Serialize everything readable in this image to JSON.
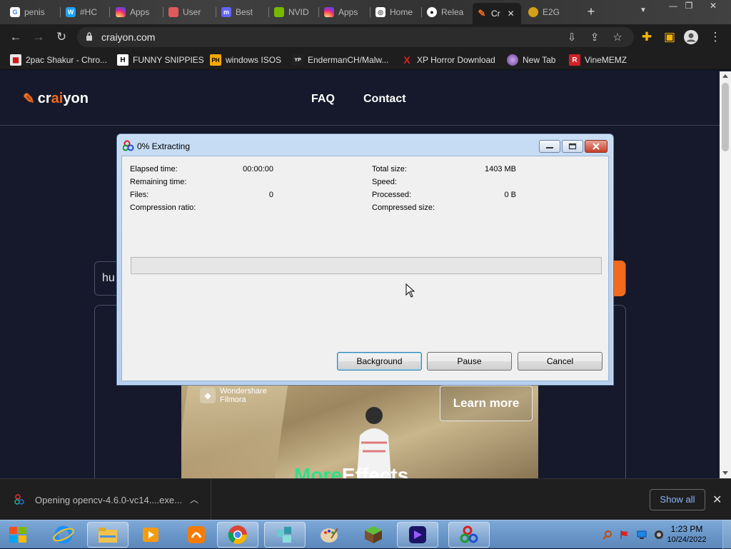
{
  "browser": {
    "tabs": [
      {
        "label": "penis",
        "icon": "google-icon",
        "color": "#ffffff"
      },
      {
        "label": "#HC",
        "icon": "w-site-icon",
        "color": "#1da1f2"
      },
      {
        "label": "Apps",
        "icon": "instagram-icon",
        "color": "#e1306c"
      },
      {
        "label": "User",
        "icon": "site-icon",
        "color": "#e05a5a"
      },
      {
        "label": "Best",
        "icon": "mastodon-icon",
        "color": "#6364ff"
      },
      {
        "label": "NVID",
        "icon": "nvidia-icon",
        "color": "#76b900"
      },
      {
        "label": "Apps",
        "icon": "instagram-icon",
        "color": "#e1306c"
      },
      {
        "label": "Home",
        "icon": "site-icon",
        "color": "#ffffff"
      },
      {
        "label": "Relea",
        "icon": "github-icon",
        "color": "#ffffff"
      },
      {
        "label": "Cr",
        "icon": "craiyon-icon",
        "color": "#f26b1d",
        "active": true
      },
      {
        "label": "E2G",
        "icon": "site-icon",
        "color": "#d4a017"
      }
    ],
    "url": "craiyon.com",
    "bookmarks": [
      {
        "label": "2pac Shakur - Chro...",
        "icon": "calendar-icon"
      },
      {
        "label": "FUNNY SNIPPIES",
        "icon": "h-icon",
        "badge": "H"
      },
      {
        "label": "windows ISOS",
        "icon": "ph-icon",
        "badge": "PH"
      },
      {
        "label": "EndermanCH/Malw...",
        "icon": "yp-icon",
        "badge": "YP"
      },
      {
        "label": "XP Horror Download",
        "icon": "x-icon",
        "badge": "X"
      },
      {
        "label": "New Tab",
        "icon": "globe-icon"
      },
      {
        "label": "VineMEMZ",
        "icon": "r-icon",
        "badge": "R"
      }
    ]
  },
  "site": {
    "logo_prefix": "cr",
    "logo_ai": "ai",
    "logo_suffix": "yon",
    "nav": {
      "faq": "FAQ",
      "contact": "Contact"
    },
    "prompt_text": "hu",
    "ad": {
      "brand_line1": "Wondershare",
      "brand_line2": "Filmora",
      "cta": "Learn more",
      "caption_highlight": "More",
      "caption_rest": "Effects"
    }
  },
  "dialog": {
    "title": "0% Extracting",
    "progress_fraction": 0,
    "fields_left": [
      {
        "label": "Elapsed time:",
        "value": "00:00:00"
      },
      {
        "label": "Remaining time:",
        "value": ""
      },
      {
        "label": "Files:",
        "value": "0"
      },
      {
        "label": "Compression ratio:",
        "value": ""
      }
    ],
    "fields_right": [
      {
        "label": "Total size:",
        "value": "1403 MB"
      },
      {
        "label": "Speed:",
        "value": ""
      },
      {
        "label": "Processed:",
        "value": "0 B"
      },
      {
        "label": "Compressed size:",
        "value": ""
      }
    ],
    "buttons": {
      "background": "Background",
      "pause": "Pause",
      "cancel": "Cancel"
    }
  },
  "downloads": {
    "item_text": "Opening opencv-4.6.0-vc14....exe...",
    "show_all": "Show all"
  },
  "taskbar": {
    "time": "1:23 PM",
    "date": "10/24/2022"
  },
  "colors": {
    "accent": "#f26b1d",
    "page_bg": "#15192b",
    "link_blue": "#8ab4f8"
  }
}
